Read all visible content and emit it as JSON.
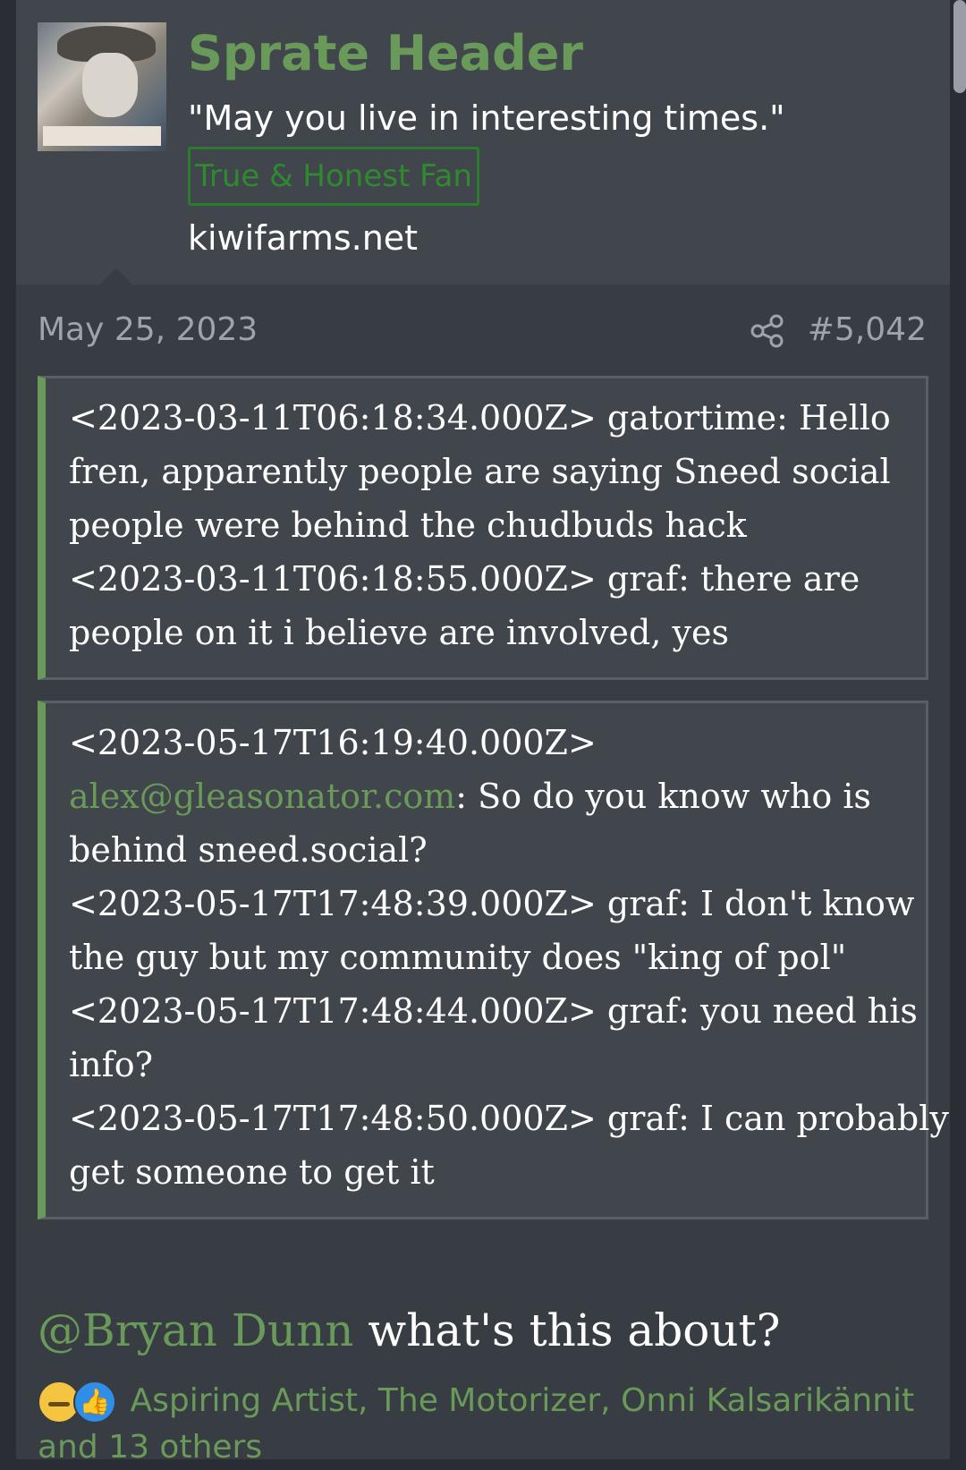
{
  "author": {
    "username": "Sprate Header",
    "user_title": "\"May you live in interesting times.\"",
    "banner": "True & Honest Fan",
    "site": "kiwifarms.net",
    "accent_color": "#6a9a5a"
  },
  "post": {
    "date": "May 25, 2023",
    "share_icon": "share-icon",
    "number": "#5,042"
  },
  "quotes": [
    {
      "lines": [
        "<2023-03-11T06:18:34.000Z> gatortime: Hello",
        "fren, apparently people are saying Sneed social",
        "people were behind the chudbuds hack",
        "<2023-03-11T06:18:55.000Z> graf: there are",
        "people on it i believe are involved, yes"
      ]
    },
    {
      "line1": "<2023-05-17T16:19:40.000Z>",
      "mention": "alex@gleasonator.com",
      "after_mention": ": So do you know who is",
      "lines": [
        "behind sneed.social?",
        "<2023-05-17T17:48:39.000Z> graf: I don't know",
        "the guy but my community does \"king of pol\"",
        "<2023-05-17T17:48:44.000Z> graf: you need his",
        "info?",
        "<2023-05-17T17:48:50.000Z> graf: I can probably",
        "get someone to get it"
      ]
    }
  ],
  "message": {
    "mention": "@Bryan Dunn",
    "text": " what's this about?"
  },
  "reactions": {
    "icons": [
      "thinking-face-icon",
      "thumbs-up-icon"
    ],
    "reactors_line1": "Aspiring Artist, The Motorizer, Onni Kalsarikännit",
    "reactors_line2": "and 13 others"
  }
}
